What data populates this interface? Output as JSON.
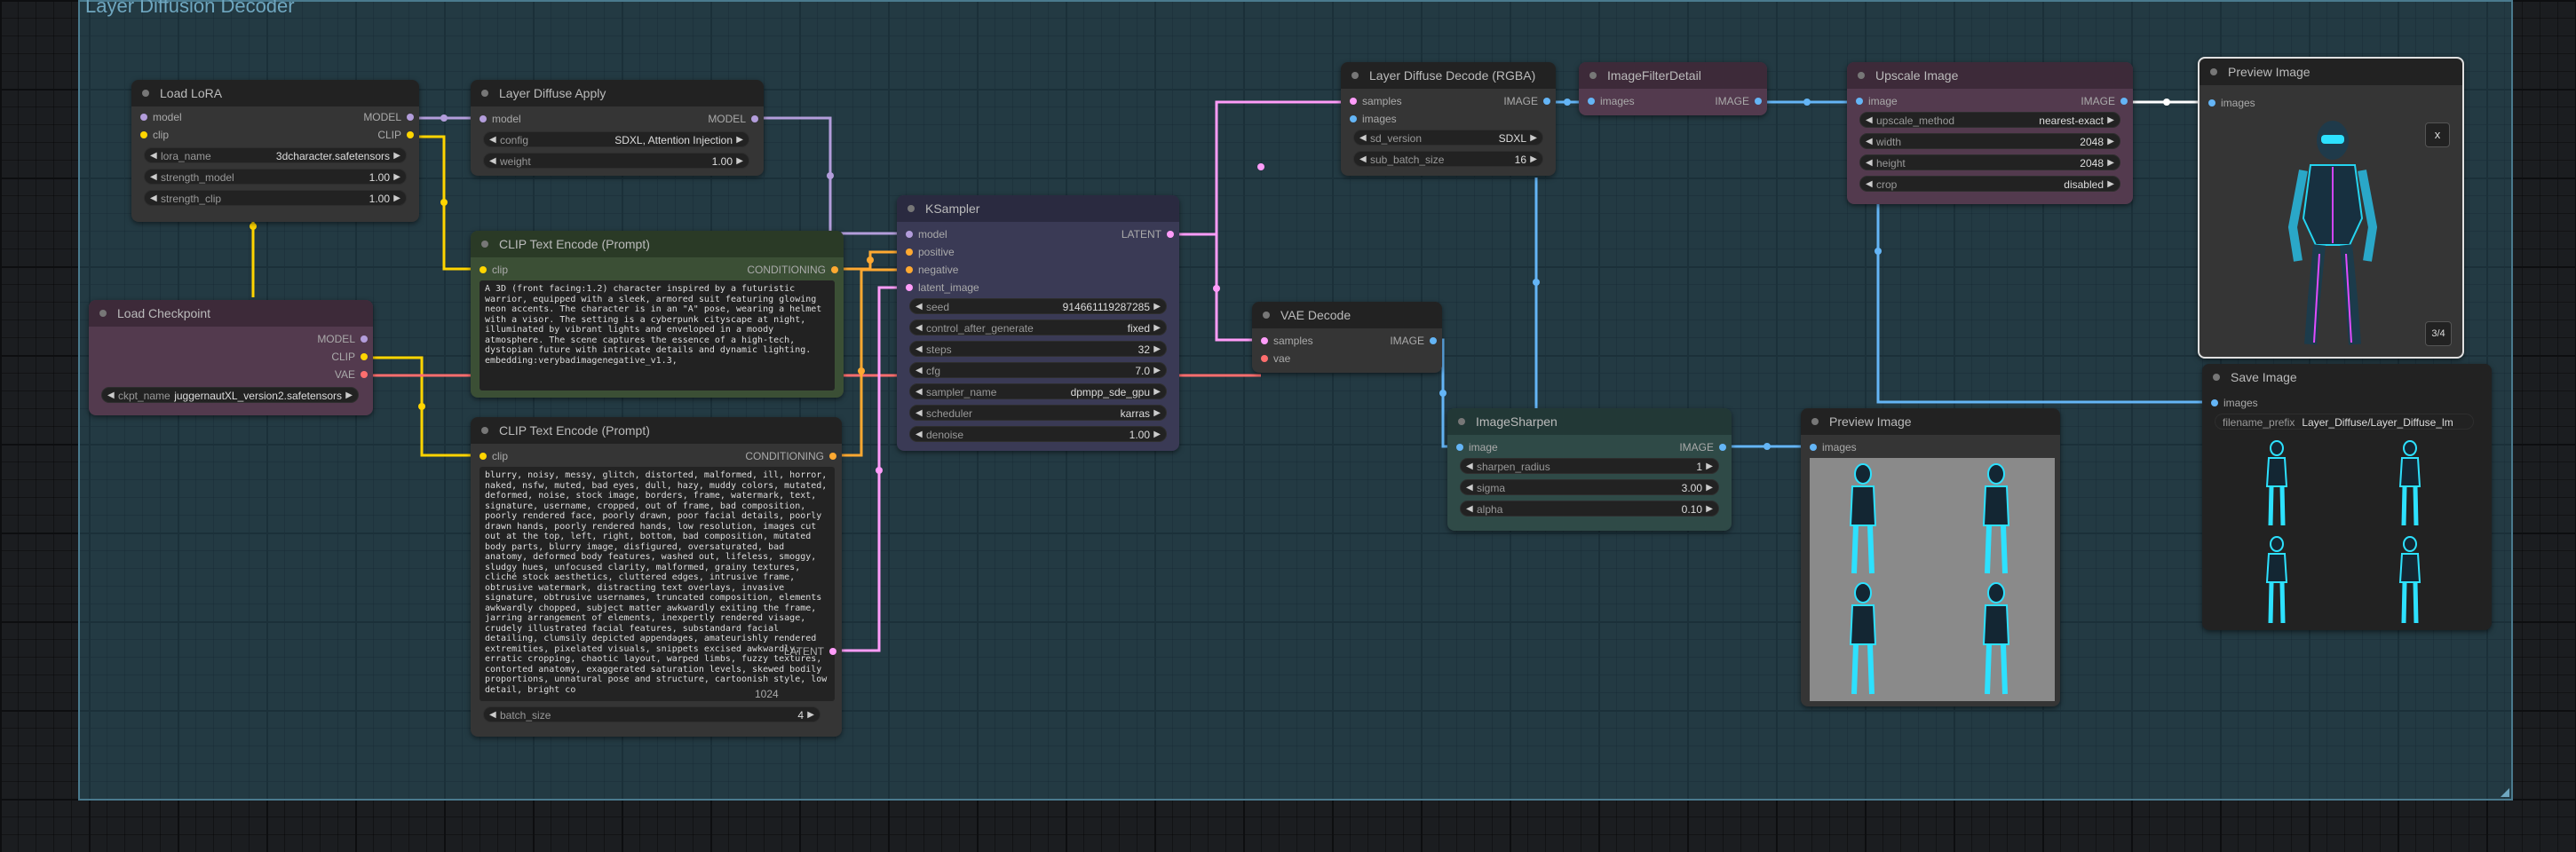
{
  "group": {
    "title": "Layer Diffusion Decoder"
  },
  "nodes": {
    "load_lora": {
      "title": "Load LoRA",
      "inputs": [
        "model",
        "clip"
      ],
      "outputs": [
        "MODEL",
        "CLIP"
      ],
      "widgets": [
        {
          "label": "lora_name",
          "value": "3dcharacter.safetensors"
        },
        {
          "label": "strength_model",
          "value": "1.00"
        },
        {
          "label": "strength_clip",
          "value": "1.00"
        }
      ]
    },
    "load_checkpoint": {
      "title": "Load Checkpoint",
      "outputs": [
        "MODEL",
        "CLIP",
        "VAE"
      ],
      "widget": {
        "label": "ckpt_name",
        "value": "juggernautXL_version2.safetensors"
      }
    },
    "layer_diffuse_apply": {
      "title": "Layer Diffuse Apply",
      "inputs": [
        "model"
      ],
      "outputs": [
        "MODEL"
      ],
      "widgets": [
        {
          "label": "config",
          "value": "SDXL, Attention Injection"
        },
        {
          "label": "weight",
          "value": "1.00"
        }
      ]
    },
    "clip_pos": {
      "title": "CLIP Text Encode (Prompt)",
      "inputs": [
        "clip"
      ],
      "outputs": [
        "CONDITIONING"
      ],
      "text": "A 3D (front facing:1.2) character inspired by a futuristic warrior, equipped with a sleek, armored suit featuring glowing neon accents. The character is in an \"A\" pose, wearing a helmet with a visor. The setting is a cyberpunk cityscape at night, illuminated by vibrant lights and enveloped in a moody atmosphere. The scene captures the essence of a high-tech, dystopian future with intricate details and dynamic lighting. embedding:verybadimagenegative_v1.3,"
    },
    "clip_neg": {
      "title": "CLIP Text Encode (Prompt)",
      "inputs": [
        "clip"
      ],
      "outputs": [
        "CONDITIONING"
      ],
      "text": "blurry, noisy, messy, glitch, distorted, malformed, ill, horror, naked, nsfw, muted, bad eyes, dull, hazy, muddy colors, mutated, deformed, noise, stock image, borders, frame, watermark, text, signature, username, cropped, out of frame, bad composition, poorly rendered face, poorly drawn, poor facial details, poorly drawn hands, poorly rendered hands, low resolution, images cut out at the top, left, right, bottom, bad composition, mutated body parts, blurry image, disfigured, oversaturated, bad anatomy, deformed body features, washed out, lifeless, smoggy, sludgy hues, unfocused clarity, malformed, grainy textures, cliché stock aesthetics, cluttered edges, intrusive frame, obtrusive watermark, distracting text overlays, invasive signature, obtrusive usernames, truncated composition, elements awkwardly chopped, subject matter awkwardly exiting the frame, jarring arrangement of elements, inexpertly rendered visage, crudely illustrated facial features, substandard facial detailing, clumsily depicted appendages, amateurishly rendered extremities, pixelated visuals, snippets excised awkwardly, erratic cropping, chaotic layout, warped limbs, fuzzy textures, contorted anatomy, exaggerated saturation levels, skewed bodily proportions, unnatural pose and structure, cartoonish style, low detail, bright co",
      "hidden_latent_label": "LATENT",
      "hidden_height_value": "1024",
      "batch_size": {
        "label": "batch_size",
        "value": "4"
      }
    },
    "ksampler": {
      "title": "KSampler",
      "inputs": [
        "model",
        "positive",
        "negative",
        "latent_image"
      ],
      "outputs": [
        "LATENT"
      ],
      "widgets": [
        {
          "label": "seed",
          "value": "914661119287285"
        },
        {
          "label": "control_after_generate",
          "value": "fixed"
        },
        {
          "label": "steps",
          "value": "32"
        },
        {
          "label": "cfg",
          "value": "7.0"
        },
        {
          "label": "sampler_name",
          "value": "dpmpp_sde_gpu"
        },
        {
          "label": "scheduler",
          "value": "karras"
        },
        {
          "label": "denoise",
          "value": "1.00"
        }
      ]
    },
    "layer_diffuse_decode": {
      "title": "Layer Diffuse Decode (RGBA)",
      "inputs": [
        "samples",
        "images"
      ],
      "outputs": [
        "IMAGE"
      ],
      "widgets": [
        {
          "label": "sd_version",
          "value": "SDXL"
        },
        {
          "label": "sub_batch_size",
          "value": "16"
        }
      ]
    },
    "vae_decode": {
      "title": "VAE Decode",
      "inputs": [
        "samples",
        "vae"
      ],
      "outputs": [
        "IMAGE"
      ]
    },
    "image_filter_detail": {
      "title": "ImageFilterDetail",
      "inputs": [
        "images"
      ],
      "outputs": [
        "IMAGE"
      ]
    },
    "upscale_image": {
      "title": "Upscale Image",
      "inputs": [
        "image"
      ],
      "outputs": [
        "IMAGE"
      ],
      "widgets": [
        {
          "label": "upscale_method",
          "value": "nearest-exact"
        },
        {
          "label": "width",
          "value": "2048"
        },
        {
          "label": "height",
          "value": "2048"
        },
        {
          "label": "crop",
          "value": "disabled"
        }
      ]
    },
    "image_sharpen": {
      "title": "ImageSharpen",
      "inputs": [
        "image"
      ],
      "outputs": [
        "IMAGE"
      ],
      "widgets": [
        {
          "label": "sharpen_radius",
          "value": "1"
        },
        {
          "label": "sigma",
          "value": "3.00"
        },
        {
          "label": "alpha",
          "value": "0.10"
        }
      ]
    },
    "preview_top": {
      "title": "Preview Image",
      "inputs": [
        "images"
      ],
      "close_label": "x",
      "counter": "3/4"
    },
    "preview_mid": {
      "title": "Preview Image",
      "inputs": [
        "images"
      ]
    },
    "save_image": {
      "title": "Save Image",
      "inputs": [
        "images"
      ],
      "widget": {
        "label": "filename_prefix",
        "value": "Layer_Diffuse/Layer_Diffuse_lm"
      }
    }
  },
  "colors": {
    "model_link": "#b39ddb",
    "clip_link": "#ffd500",
    "vae_link": "#ff6e6e",
    "conditioning_link": "#ffa931",
    "latent_link": "#ff9cf9",
    "image_link": "#64b5f6",
    "lora_bg": "#353535",
    "checkpoint_bg": "#533a4e",
    "clip_pos_bg": "#3b4f35",
    "ksampler_bg": "#3a3a55",
    "filter_bg": "#533a4e",
    "upscale_bg": "#533a4e",
    "sharpen_bg": "#2f4a47",
    "save_bg": "#222"
  }
}
